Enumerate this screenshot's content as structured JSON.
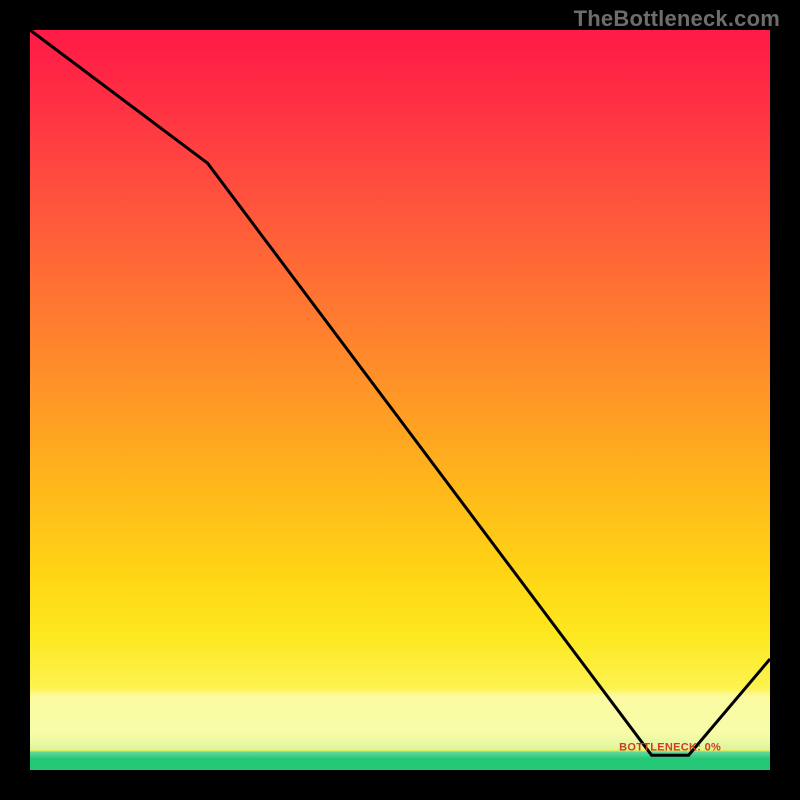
{
  "watermark": "TheBottleneck.com",
  "chart_data": {
    "type": "line",
    "title": "",
    "xlabel": "",
    "ylabel": "",
    "xlim": [
      0,
      100
    ],
    "ylim": [
      0,
      100
    ],
    "x": [
      0,
      24,
      84,
      89,
      100
    ],
    "values": [
      100,
      82,
      2,
      2,
      15
    ],
    "annotations": [
      {
        "text": "BOTTLENECK: 0%",
        "x": 86.5,
        "y": 3
      }
    ],
    "background_gradient": {
      "top": "#ff1a47",
      "mid": "#ffd615",
      "band": "#fbfaa0",
      "bottom": "#23c776"
    }
  }
}
